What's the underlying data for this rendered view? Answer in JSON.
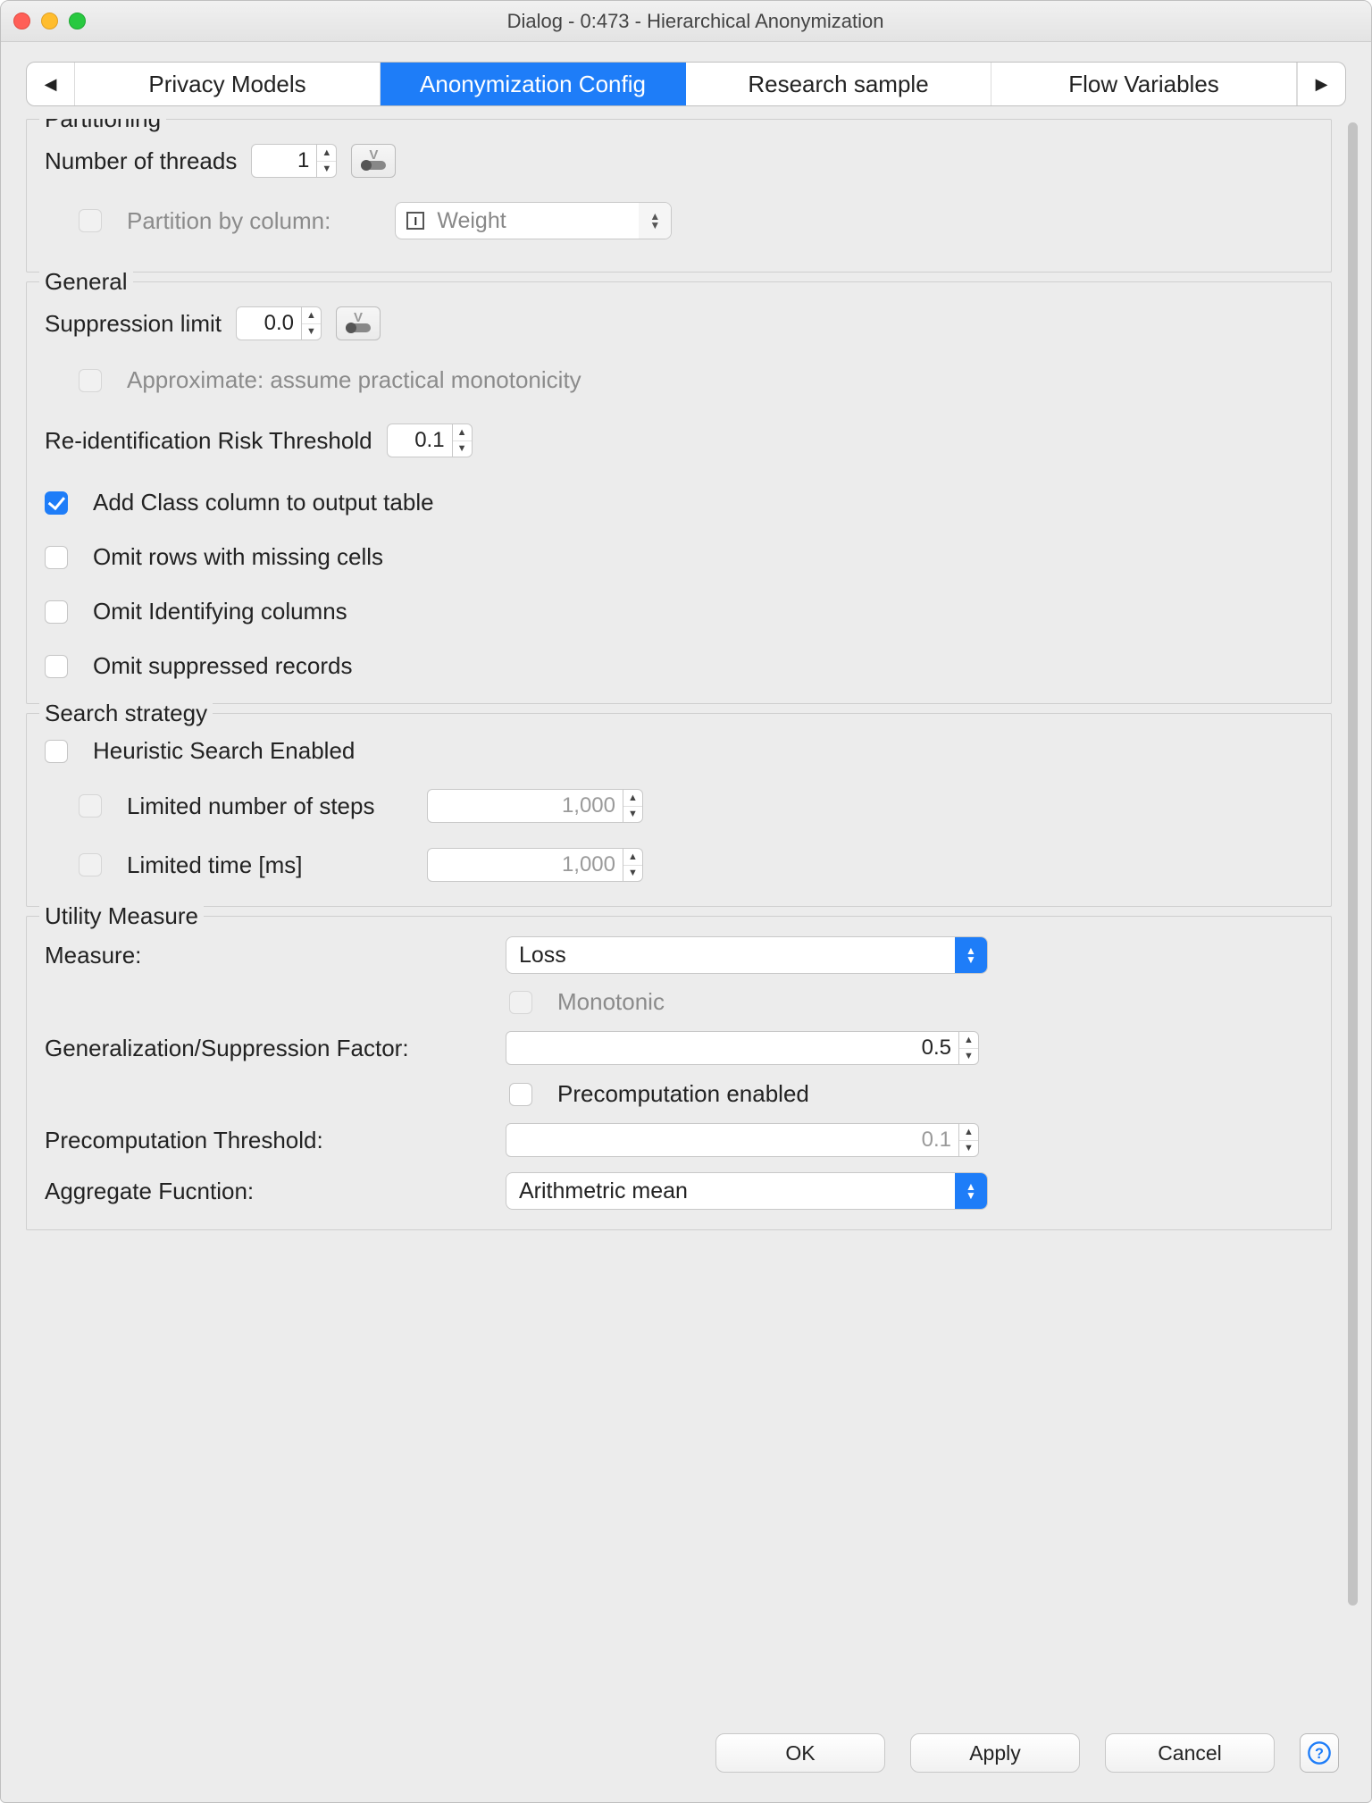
{
  "window": {
    "title": "Dialog - 0:473 - Hierarchical Anonymization"
  },
  "tabs": {
    "items": [
      "Privacy Models",
      "Anonymization Config",
      "Research sample",
      "Flow Variables"
    ],
    "activeIndex": 1
  },
  "partitioning": {
    "title": "Partitioning",
    "numThreadsLabel": "Number of threads",
    "numThreadsValue": "1",
    "partitionByColumnLabel": "Partition by column:",
    "partitionByColumnEnabled": false,
    "partitionColumnSelected": "Weight"
  },
  "general": {
    "title": "General",
    "suppressionLimitLabel": "Suppression limit",
    "suppressionLimitValue": "0.0",
    "approxLabel": "Approximate: assume practical monotonicity",
    "approxEnabled": false,
    "reidRiskLabel": "Re-identification Risk Threshold",
    "reidRiskValue": "0.1",
    "addClassLabel": "Add Class column to output table",
    "addClassChecked": true,
    "omitMissingLabel": "Omit rows with missing cells",
    "omitMissingChecked": false,
    "omitIdentLabel": "Omit Identifying columns",
    "omitIdentChecked": false,
    "omitSuppressedLabel": "Omit suppressed records",
    "omitSuppressedChecked": false
  },
  "search": {
    "title": "Search strategy",
    "heuristicLabel": "Heuristic Search Enabled",
    "heuristicChecked": false,
    "limitedStepsLabel": "Limited number of steps",
    "limitedStepsValue": "1,000",
    "limitedStepsEnabled": false,
    "limitedTimeLabel": "Limited time [ms]",
    "limitedTimeValue": "1,000",
    "limitedTimeEnabled": false
  },
  "utility": {
    "title": "Utility Measure",
    "measureLabel": "Measure:",
    "measureValue": "Loss",
    "monotonicLabel": "Monotonic",
    "monotonicEnabled": false,
    "gsFactorLabel": "Generalization/Suppression Factor:",
    "gsFactorValue": "0.5",
    "precompEnabledLabel": "Precomputation enabled",
    "precompEnabledChecked": false,
    "precompThreshLabel": "Precomputation Threshold:",
    "precompThreshValue": "0.1",
    "precompThreshEnabled": false,
    "aggFuncLabel": "Aggregate Fucntion:",
    "aggFuncValue": "Arithmetric mean"
  },
  "footer": {
    "ok": "OK",
    "apply": "Apply",
    "cancel": "Cancel"
  }
}
